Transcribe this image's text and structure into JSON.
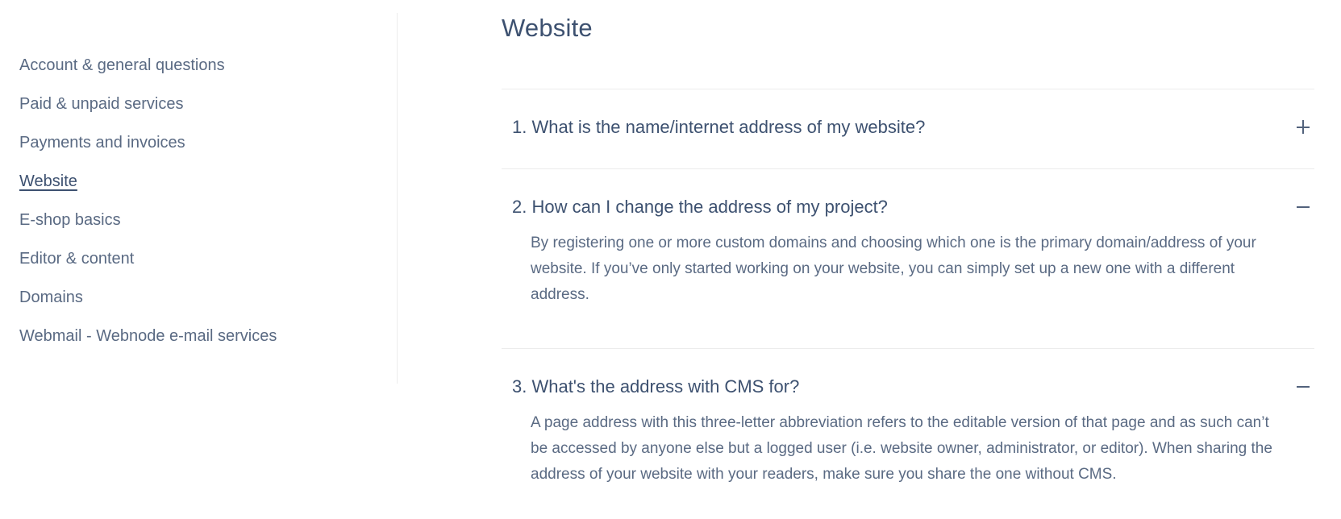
{
  "sidebar": {
    "items": [
      {
        "label": "Account & general questions",
        "active": false
      },
      {
        "label": "Paid & unpaid services",
        "active": false
      },
      {
        "label": "Payments and invoices",
        "active": false
      },
      {
        "label": "Website",
        "active": true
      },
      {
        "label": "E-shop basics",
        "active": false
      },
      {
        "label": "Editor & content",
        "active": false
      },
      {
        "label": "Domains",
        "active": false
      },
      {
        "label": "Webmail - Webnode e-mail services",
        "active": false
      }
    ]
  },
  "main": {
    "title": "Website",
    "faq": [
      {
        "question": "1. What is the name/internet address of my website?",
        "expanded": false,
        "icon": "plus-icon",
        "answer": ""
      },
      {
        "question": "2. How can I change the address of my project?",
        "expanded": true,
        "icon": "minus-icon",
        "answer": "By registering one or more custom domains and choosing which one is the primary domain/address of your website. If you’ve only started working on your website, you can simply set up a new one with a different address."
      },
      {
        "question": "3. What's the address with CMS for?",
        "expanded": true,
        "icon": "minus-icon",
        "answer": "A page address with this three-letter abbreviation refers to the editable version of that page and as such can’t be accessed by anyone else but a logged user (i.e. website owner, administrator, or editor). When sharing the address of your website with your readers, make sure you share the one without CMS."
      }
    ]
  },
  "colors": {
    "heading": "#3d5170",
    "body_text": "#5a6a83",
    "divider": "#ececec",
    "background": "#ffffff"
  }
}
